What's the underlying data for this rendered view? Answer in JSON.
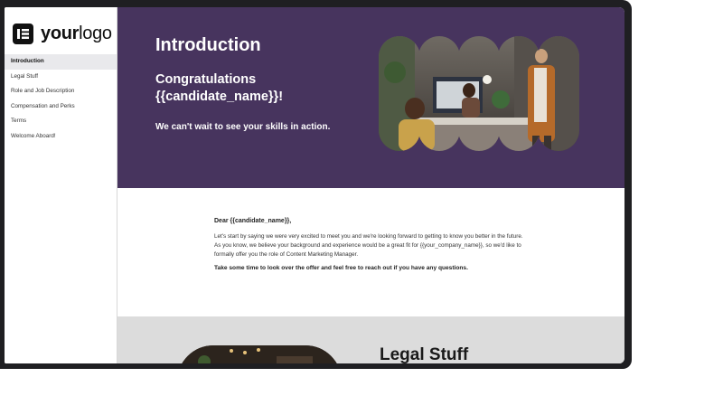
{
  "logo": {
    "text_bold": "your",
    "text_light": "logo"
  },
  "sidebar": {
    "items": [
      {
        "label": "Introduction",
        "active": true
      },
      {
        "label": "Legal Stuff"
      },
      {
        "label": "Role and Job Description"
      },
      {
        "label": "Compensation and Perks"
      },
      {
        "label": "Terms"
      },
      {
        "label": "Welcome Aboard!"
      }
    ]
  },
  "hero": {
    "title": "Introduction",
    "congrats": "Congratulations {{candidate_name}}!",
    "tagline": "We can't wait to see your skills in action."
  },
  "letter": {
    "greeting": "Dear {{candidate_name}},",
    "body": "Let's start by saying we were very excited to meet you and we're looking forward to getting to know you better in the future. As you know, we believe your background and experience would be a great fit for {{your_company_name}}, so we'd like to formally offer you the role of Content Marketing Manager.",
    "closing": "Take some time to look over the offer and feel free to reach out if you have any questions."
  },
  "legal": {
    "title": "Legal Stuff"
  },
  "colors": {
    "hero_bg": "#47345e",
    "frame": "#1f1f22",
    "legal_bg": "#dcdcdc"
  }
}
